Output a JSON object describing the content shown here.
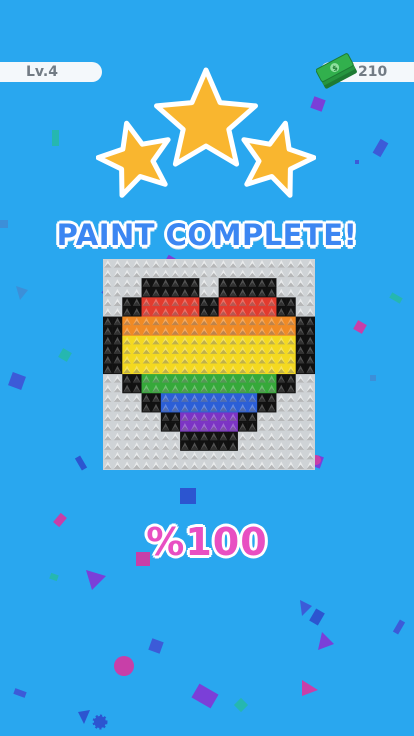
{
  "hud": {
    "level_label": "Lv.4",
    "money_amount": "210",
    "money_icon": "cash-stack-icon"
  },
  "result": {
    "stars_earned": 3,
    "stars_total": 3,
    "title": "PAINT COMPLETE!",
    "percent_text": "%100"
  },
  "artwork": {
    "subject": "rainbow-heart",
    "colors": {
      "background": "#29a7ef",
      "star": "#f9b62f",
      "outline": "#111111",
      "silver": "#cfd3d6",
      "red": "#e23b2e",
      "orange": "#f08a24",
      "yellow": "#f4d920",
      "green": "#36a93a",
      "blue": "#2c5fd6",
      "purple": "#7c34c4",
      "title": "#3c86f2",
      "percent": "#e84fc2"
    }
  }
}
